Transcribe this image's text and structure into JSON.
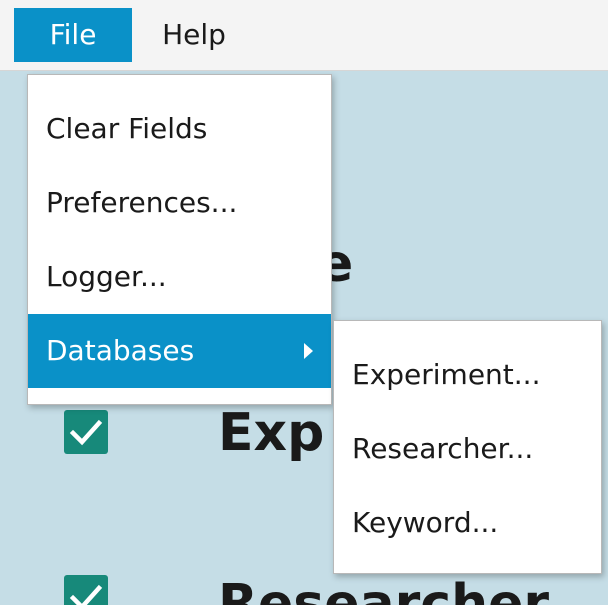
{
  "menubar": {
    "file_label": "File",
    "help_label": "Help"
  },
  "background": {
    "partial_heading_1": "e",
    "checkbox_1_label": "Exp",
    "checkbox_2_label": "Researcher"
  },
  "file_menu": {
    "items": [
      {
        "label": "Clear Fields"
      },
      {
        "label": "Preferences..."
      },
      {
        "label": "Logger..."
      },
      {
        "label": "Databases"
      }
    ]
  },
  "databases_submenu": {
    "items": [
      {
        "label": "Experiment..."
      },
      {
        "label": "Researcher..."
      },
      {
        "label": "Keyword..."
      }
    ]
  },
  "colors": {
    "accent": "#0a91c8",
    "background": "#c5dde6",
    "checkbox": "#17897a"
  },
  "icons": {
    "submenu_arrow": "chevron-right-icon",
    "checkbox": "checkmark-icon"
  }
}
